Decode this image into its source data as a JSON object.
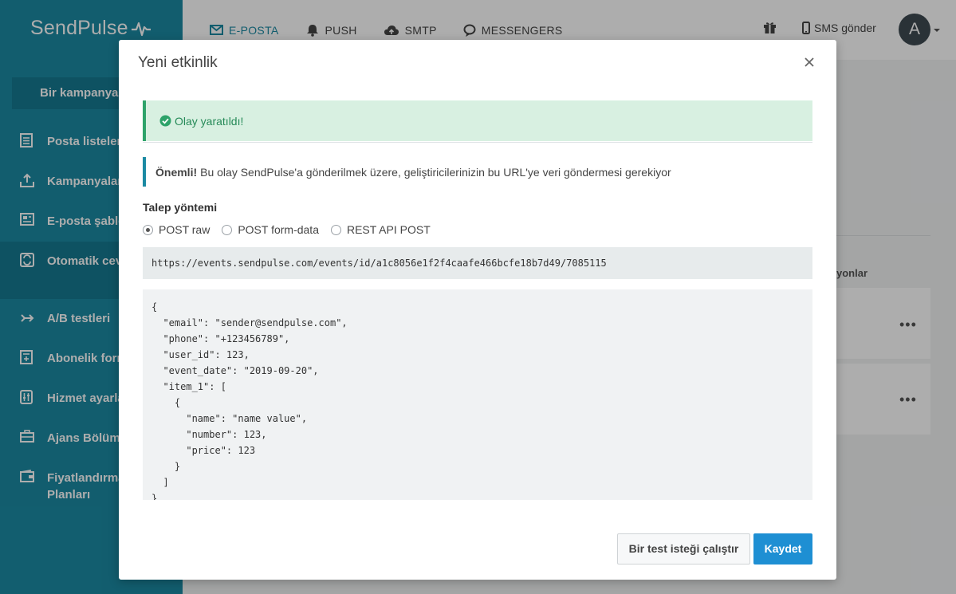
{
  "header": {
    "logo": "SendPulse",
    "nav": [
      {
        "label": "E-POSTA",
        "icon": "envelope-icon",
        "active": true
      },
      {
        "label": "PUSH",
        "icon": "bell-icon"
      },
      {
        "label": "SMTP",
        "icon": "cloud-upload-icon"
      },
      {
        "label": "MESSENGERS",
        "icon": "chat-bubble-icon"
      }
    ],
    "gift_icon": "gift-icon",
    "sms_label": "SMS gönder",
    "avatar_letter": "A"
  },
  "sidebar": {
    "create_button": "Bir kampanya oluşturun",
    "items": [
      {
        "label": "Posta listeleri",
        "icon": "list-icon"
      },
      {
        "label": "Kampanyalar",
        "icon": "upload-tray-icon"
      },
      {
        "label": "E-posta şablonları",
        "icon": "template-icon"
      },
      {
        "label": "Otomatik cevaplayıcılar",
        "icon": "autoresponder-icon",
        "active": true
      },
      {
        "label": "A/B testleri",
        "icon": "ab-test-icon"
      },
      {
        "label": "Abonelik formları",
        "icon": "form-icon"
      },
      {
        "label": "Hizmet ayarları",
        "icon": "settings-sliders-icon"
      },
      {
        "label": "Ajans Bölümü",
        "icon": "briefcase-icon"
      },
      {
        "label": "Fiyatlandırma Planları",
        "icon": "wallet-icon"
      }
    ]
  },
  "background": {
    "column_label": "yonlar",
    "more_label": "•••"
  },
  "modal": {
    "title": "Yeni etkinlik",
    "success_message": "Olay yaratıldı!",
    "info_bold": "Önemli!",
    "info_text": "Bu olay SendPulse'a gönderilmek üzere, geliştiricilerinizin bu URL'ye veri göndermesi gerekiyor",
    "method_label": "Talep yöntemi",
    "methods": [
      {
        "label": "POST raw",
        "checked": true
      },
      {
        "label": "POST form-data",
        "checked": false
      },
      {
        "label": "REST API POST",
        "checked": false
      }
    ],
    "url": "https://events.sendpulse.com/events/id/a1c8056e1f2f4caafe466bcfe18b7d49/7085115",
    "code": "{\n  \"email\": \"sender@sendpulse.com\",\n  \"phone\": \"+123456789\",\n  \"user_id\": 123,\n  \"event_date\": \"2019-09-20\",\n  \"item_1\": [\n    {\n      \"name\": \"name value\",\n      \"number\": 123,\n      \"price\": 123\n    }\n  ]\n}",
    "test_button": "Bir test isteği çalıştır",
    "save_button": "Kaydet"
  },
  "colors": {
    "brand": "#1b8aa3",
    "success": "#2ea36a",
    "primary_button": "#1e8fd3"
  }
}
